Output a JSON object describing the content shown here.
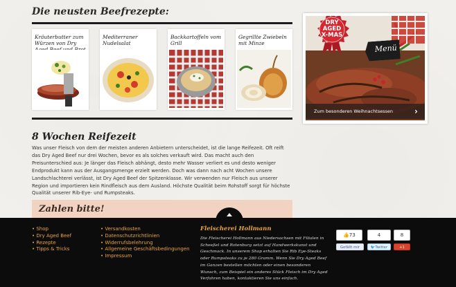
{
  "main": {
    "section_title": "Die neusten Beefrezepte:",
    "recipes": [
      {
        "title": "Kräuterbutter zum Würzen von Dry Aged Beef und Brot"
      },
      {
        "title": "Mediterraner Nudelsalat"
      },
      {
        "title": "Backkartoffeln vom Grill"
      },
      {
        "title": "Gegrillte Zwiebeln mit Minze"
      }
    ],
    "reife": {
      "title": "8 Wochen Reifezeit",
      "text": "Was unser Fleisch von dem der meisten anderen Anbietern unterscheidet, ist die lange Reifezeit. Oft reift das Dry Aged Beef nur drei Wochen, bevor es als solches verkauft wird. Das macht auch den Preisunterschied aus: Je länger das Fleisch abhängt, desto mehr Wasser verliert es und desto weniger Endprodukt kann aus der Ausgangsmenge erzielt werden. Doch was dann nach acht Wochen unsere Landschlachterei verlässt, ist Dry Aged Beef der Spitzenklasse. Wir verwenden nur Fleisch aus unserer Region und importieren kein Rindfleisch aus dem Ausland. Höchste Qualität beim Rohstoff sorgt für höchste Qualität unserer Rib-Eye- und Rumpsteaks."
    },
    "zahlen_title": "Zahlen bitte!"
  },
  "promo": {
    "badge_line1": "DRY",
    "badge_line2": "AGED",
    "badge_line3": "X-MAS",
    "menu_tag": "Menü",
    "bar_label": "Zum besonderen Weihnachtsessen",
    "bar_arrow": "›"
  },
  "footer": {
    "links_col1": [
      "Shop",
      "Dry Aged Beef",
      "Rezepte",
      "Tipps & Tricks"
    ],
    "links_col2": [
      "Versandkosten",
      "Datenschutzrichtlinien",
      "Widerrufsbelehrung",
      "Allgemeine Geschäftsbedingungen",
      "Impressum"
    ],
    "company_title": "Fleischerei Hollmann",
    "company_text": "Die Fleischerei Hollmann aus Niedersachsen mit Filialen in Scheeßel und Rotenburg setzt auf Handwerkskunst und Geschmack. In unserem Shop erhalten Sie Rib Eye-Steaks oder Rumpsteaks zu je 280 Gramm. Wenn Sie Dry Aged Beef im Ganzen bestellen möchten oder einen besonderen Wunsch, zum Beispiel ein anderes Stück Fleisch im Dry Aged Verfahren haben, kontaktieren Sie uns einfach."
  },
  "social": {
    "fb_count": "73",
    "fb_label": "Gefällt mir",
    "tw_count": "4",
    "tw_label": "Twitter",
    "gp_count": "8",
    "gp_label": "+1"
  },
  "colors": {
    "accent_orange": "#e8a33a",
    "footer_bg": "#0c0c0c",
    "zahlen_bg": "#f2d3c1"
  }
}
